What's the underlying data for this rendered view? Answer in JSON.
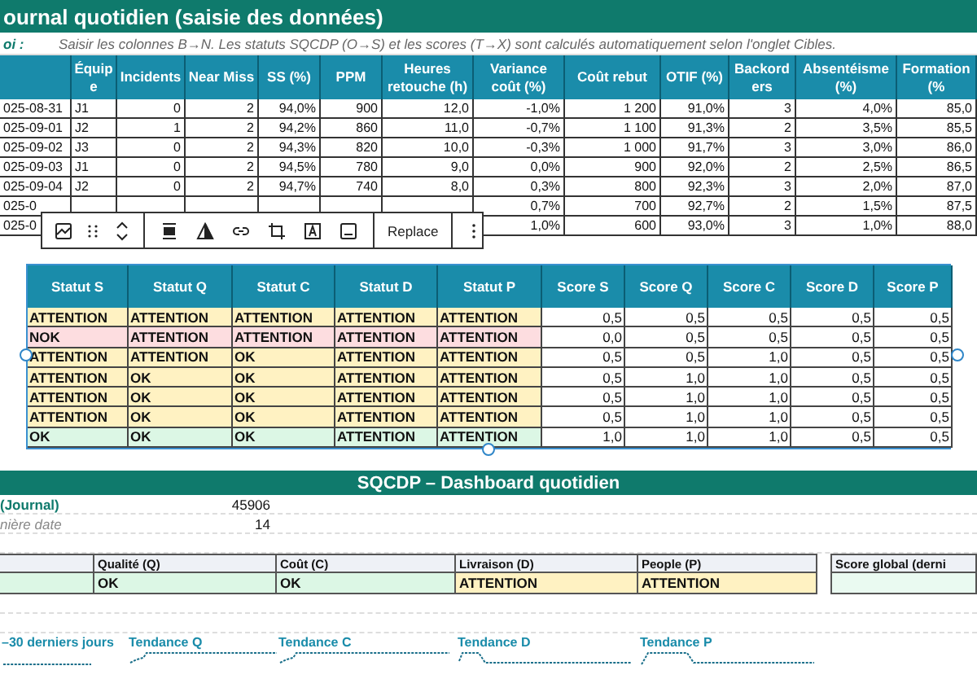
{
  "journal": {
    "title": "ournal quotidien (saisie des données)",
    "note_label": "oi :",
    "note": "Saisir les colonnes B→N. Les statuts SQCDP (O→S) et les scores (T→X) sont calculés automatiquement selon l'onglet Cibles.",
    "columns": [
      "Équipe",
      "Incidents",
      "Near Miss",
      "SS (%)",
      "PPM",
      "Heures retouche (h)",
      "Variance coût (%)",
      "Coût rebut",
      "OTIF (%)",
      "Backorders",
      "Absentéisme (%)",
      "Formation (%"
    ],
    "rows": [
      {
        "date": "025-08-31",
        "values": [
          "J1",
          "0",
          "2",
          "94,0%",
          "900",
          "12,0",
          "-1,0%",
          "1 200",
          "91,0%",
          "3",
          "4,0%",
          "85,0"
        ]
      },
      {
        "date": "025-09-01",
        "values": [
          "J2",
          "1",
          "2",
          "94,2%",
          "860",
          "11,0",
          "-0,7%",
          "1 100",
          "91,3%",
          "2",
          "3,5%",
          "85,5"
        ]
      },
      {
        "date": "025-09-02",
        "values": [
          "J3",
          "0",
          "2",
          "94,3%",
          "820",
          "10,0",
          "-0,3%",
          "1 000",
          "91,7%",
          "3",
          "3,0%",
          "86,0"
        ]
      },
      {
        "date": "025-09-03",
        "values": [
          "J1",
          "0",
          "2",
          "94,5%",
          "780",
          "9,0",
          "0,0%",
          "900",
          "92,0%",
          "2",
          "2,5%",
          "86,5"
        ]
      },
      {
        "date": "025-09-04",
        "values": [
          "J2",
          "0",
          "2",
          "94,7%",
          "740",
          "8,0",
          "0,3%",
          "800",
          "92,3%",
          "3",
          "2,0%",
          "87,0"
        ]
      },
      {
        "date": "025-0",
        "values": [
          "0,7%",
          "700",
          "92,7%",
          "2",
          "1,5%",
          "87,5"
        ]
      },
      {
        "date": "025-0",
        "values": [
          "1,0%",
          "600",
          "93,0%",
          "3",
          "1,0%",
          "88,0"
        ]
      }
    ]
  },
  "image_toolbar": {
    "replace": "Replace"
  },
  "status_table": {
    "columns": [
      "Statut S",
      "Statut Q",
      "Statut C",
      "Statut D",
      "Statut P",
      "Score S",
      "Score Q",
      "Score C",
      "Score D",
      "Score P"
    ],
    "rows": [
      {
        "kind": "attention",
        "statuses": [
          "ATTENTION",
          "ATTENTION",
          "ATTENTION",
          "ATTENTION",
          "ATTENTION"
        ],
        "scores": [
          "0,5",
          "0,5",
          "0,5",
          "0,5",
          "0,5"
        ]
      },
      {
        "kind": "nok",
        "statuses": [
          "NOK",
          "ATTENTION",
          "ATTENTION",
          "ATTENTION",
          "ATTENTION"
        ],
        "scores": [
          "0,0",
          "0,5",
          "0,5",
          "0,5",
          "0,5"
        ]
      },
      {
        "kind": "attention",
        "statuses": [
          "ATTENTION",
          "ATTENTION",
          "OK",
          "ATTENTION",
          "ATTENTION"
        ],
        "scores": [
          "0,5",
          "0,5",
          "1,0",
          "0,5",
          "0,5"
        ]
      },
      {
        "kind": "attention",
        "statuses": [
          "ATTENTION",
          "OK",
          "OK",
          "ATTENTION",
          "ATTENTION"
        ],
        "scores": [
          "0,5",
          "1,0",
          "1,0",
          "0,5",
          "0,5"
        ]
      },
      {
        "kind": "attention",
        "statuses": [
          "ATTENTION",
          "OK",
          "OK",
          "ATTENTION",
          "ATTENTION"
        ],
        "scores": [
          "0,5",
          "1,0",
          "1,0",
          "0,5",
          "0,5"
        ]
      },
      {
        "kind": "attention",
        "statuses": [
          "ATTENTION",
          "OK",
          "OK",
          "ATTENTION",
          "ATTENTION"
        ],
        "scores": [
          "0,5",
          "1,0",
          "1,0",
          "0,5",
          "0,5"
        ]
      },
      {
        "kind": "ok",
        "statuses": [
          "OK",
          "OK",
          "OK",
          "ATTENTION",
          "ATTENTION"
        ],
        "scores": [
          "1,0",
          "1,0",
          "1,0",
          "0,5",
          "0,5"
        ]
      }
    ]
  },
  "dashboard": {
    "title": "SQCDP – Dashboard quotidien",
    "info_rows": [
      {
        "kind": "heading",
        "label": "(Journal)",
        "value": "45906"
      },
      {
        "kind": "note",
        "label": "nière date",
        "value": "14"
      }
    ],
    "statuses": [
      {
        "kind": "ok"
      },
      {
        "kind": "ok",
        "label": "Qualité (Q)",
        "value": "OK"
      },
      {
        "kind": "ok",
        "label": "Coût (C)",
        "value": "OK"
      },
      {
        "kind": "attention",
        "label": "Livraison (D)",
        "value": "ATTENTION"
      },
      {
        "kind": "attention",
        "label": "People (P)",
        "value": "ATTENTION"
      }
    ],
    "score_global": {
      "label": "Score global (derni",
      "kind": "ok"
    },
    "trends": [
      "–30 derniers jours",
      "Tendance Q",
      "Tendance C",
      "Tendance D",
      "Tendance P"
    ]
  }
}
